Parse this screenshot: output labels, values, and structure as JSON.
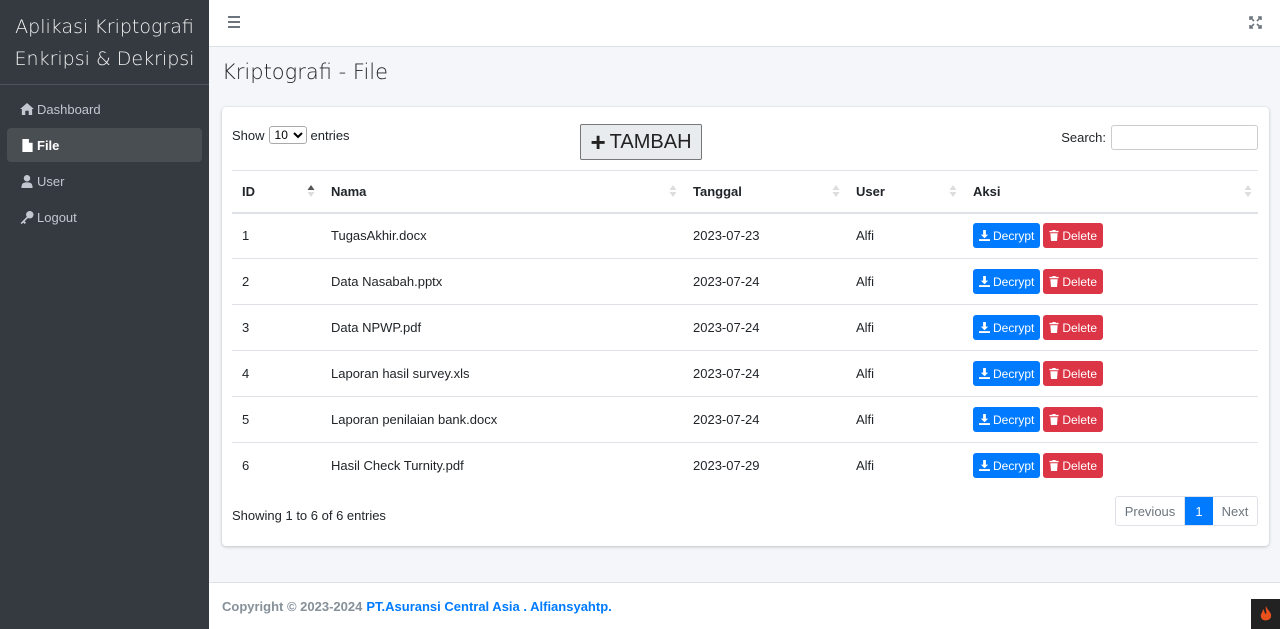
{
  "sidebar": {
    "brand_line1": "Aplikasi Kriptografi",
    "brand_line2": "Enkripsi & Dekripsi",
    "items": [
      {
        "label": "Dashboard",
        "icon": "home-icon",
        "active": false
      },
      {
        "label": "File",
        "icon": "file-icon",
        "active": true
      },
      {
        "label": "User",
        "icon": "user-icon",
        "active": false
      },
      {
        "label": "Logout",
        "icon": "key-icon",
        "active": false
      }
    ]
  },
  "page": {
    "title": "Kriptografi - File"
  },
  "controls": {
    "show_label": "Show",
    "entries_label": "entries",
    "page_size": "10",
    "tambah_label": "TAMBAH",
    "search_label": "Search:",
    "search_value": ""
  },
  "table": {
    "headers": [
      "ID",
      "Nama",
      "Tanggal",
      "User",
      "Aksi"
    ],
    "rows": [
      {
        "id": "1",
        "nama": "TugasAkhir.docx",
        "tanggal": "2023-07-23",
        "user": "Alfi"
      },
      {
        "id": "2",
        "nama": "Data Nasabah.pptx",
        "tanggal": "2023-07-24",
        "user": "Alfi"
      },
      {
        "id": "3",
        "nama": "Data NPWP.pdf",
        "tanggal": "2023-07-24",
        "user": "Alfi"
      },
      {
        "id": "4",
        "nama": "Laporan hasil survey.xls",
        "tanggal": "2023-07-24",
        "user": "Alfi"
      },
      {
        "id": "5",
        "nama": "Laporan penilaian bank.docx",
        "tanggal": "2023-07-24",
        "user": "Alfi"
      },
      {
        "id": "6",
        "nama": "Hasil Check Turnity.pdf",
        "tanggal": "2023-07-29",
        "user": "Alfi"
      }
    ],
    "decrypt_label": "Decrypt",
    "delete_label": "Delete"
  },
  "pagination": {
    "info": "Showing 1 to 6 of 6 entries",
    "previous": "Previous",
    "current": "1",
    "next": "Next"
  },
  "footer": {
    "copyright": "Copyright © 2023-2024",
    "link": "PT.Asuransi Central Asia . Alfiansyahtp."
  },
  "colors": {
    "primary": "#007bff",
    "danger": "#dc3545",
    "sidebar": "#343a40"
  }
}
